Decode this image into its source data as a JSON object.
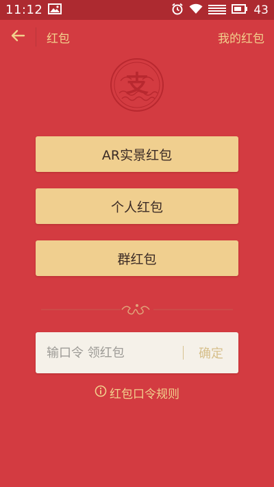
{
  "status_bar": {
    "time": "11:12",
    "battery_level": "43",
    "icons": [
      "image-icon",
      "alarm-icon",
      "wifi-icon",
      "signal-icon",
      "battery-icon"
    ]
  },
  "header": {
    "title": "红包",
    "my_red_packets": "我的红包",
    "back_icon": "arrow-left-icon"
  },
  "logo": {
    "glyph": "支"
  },
  "menu": {
    "ar_red_packet": "AR实景红包",
    "personal_red_packet": "个人红包",
    "group_red_packet": "群红包"
  },
  "password_input": {
    "placeholder": "输口令 领红包",
    "value": "",
    "confirm_label": "确定"
  },
  "rules": {
    "label": "红包口令规则",
    "icon": "info-circle-icon"
  },
  "colors": {
    "background": "#d33b41",
    "status_bar": "#ad2a30",
    "gold": "#f2d18d",
    "button": "#f0cf8f",
    "input_bg": "#f5f1e9"
  }
}
